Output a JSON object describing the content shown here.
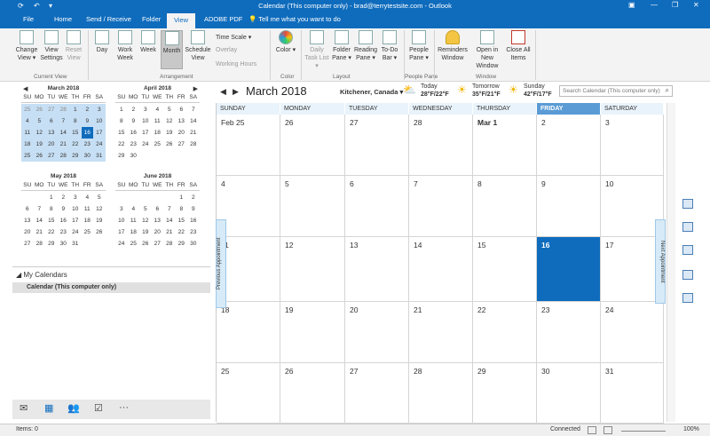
{
  "window": {
    "title": "Calendar (This computer only) - brad@terrytestsite.com - Outlook",
    "controls": [
      "▣",
      "—",
      "❐",
      "✕"
    ]
  },
  "menu": {
    "tabs": [
      "File",
      "Home",
      "Send / Receive",
      "Folder",
      "View",
      "ADOBE PDF"
    ],
    "tell_me": "Tell me what you want to do"
  },
  "ribbon": {
    "current_view": {
      "label": "Current View",
      "change_view": "Change View ▾",
      "view_settings": "View Settings",
      "reset_view": "Reset View"
    },
    "arrangement": {
      "label": "Arrangement",
      "day": "Day",
      "work_week": "Work Week",
      "week": "Week",
      "month": "Month",
      "schedule_view": "Schedule View",
      "time_scale": "Time Scale ▾",
      "overlay": "Overlay",
      "working_hours": "Working Hours"
    },
    "color": {
      "label": "Color",
      "color": "Color ▾"
    },
    "layout": {
      "label": "Layout",
      "daily_task_list": "Daily Task List ▾",
      "folder_pane": "Folder Pane ▾",
      "reading_pane": "Reading Pane ▾",
      "todo_bar": "To-Do Bar ▾"
    },
    "people_pane": {
      "label": "People Pane",
      "people_pane": "People Pane ▾"
    },
    "window": {
      "label": "Window",
      "reminders": "Reminders Window",
      "open_new": "Open in New Window",
      "close_all": "Close All Items"
    }
  },
  "mini_calendars": [
    {
      "title": "March 2018",
      "weeks": [
        [
          "25",
          "26",
          "27",
          "28",
          "1",
          "2",
          "3"
        ],
        [
          "4",
          "5",
          "6",
          "7",
          "8",
          "9",
          "10"
        ],
        [
          "11",
          "12",
          "13",
          "14",
          "15",
          "16",
          "17"
        ],
        [
          "18",
          "19",
          "20",
          "21",
          "22",
          "23",
          "24"
        ],
        [
          "25",
          "26",
          "27",
          "28",
          "29",
          "30",
          "31"
        ]
      ],
      "today": "16"
    },
    {
      "title": "April 2018",
      "weeks": [
        [
          "1",
          "2",
          "3",
          "4",
          "5",
          "6",
          "7"
        ],
        [
          "8",
          "9",
          "10",
          "11",
          "12",
          "13",
          "14"
        ],
        [
          "15",
          "16",
          "17",
          "18",
          "19",
          "20",
          "21"
        ],
        [
          "22",
          "23",
          "24",
          "25",
          "26",
          "27",
          "28"
        ],
        [
          "29",
          "30",
          "",
          "",
          "",
          "",
          ""
        ]
      ]
    },
    {
      "title": "May 2018",
      "weeks": [
        [
          "",
          "",
          "1",
          "2",
          "3",
          "4",
          "5"
        ],
        [
          "6",
          "7",
          "8",
          "9",
          "10",
          "11",
          "12"
        ],
        [
          "13",
          "14",
          "15",
          "16",
          "17",
          "18",
          "19"
        ],
        [
          "20",
          "21",
          "22",
          "23",
          "24",
          "25",
          "26"
        ],
        [
          "27",
          "28",
          "29",
          "30",
          "31",
          "",
          ""
        ]
      ]
    },
    {
      "title": "June 2018",
      "weeks": [
        [
          "",
          "",
          "",
          "",
          "",
          "1",
          "2"
        ],
        [
          "3",
          "4",
          "5",
          "6",
          "7",
          "8",
          "9"
        ],
        [
          "10",
          "11",
          "12",
          "13",
          "14",
          "15",
          "16"
        ],
        [
          "17",
          "18",
          "19",
          "20",
          "21",
          "22",
          "23"
        ],
        [
          "24",
          "25",
          "26",
          "27",
          "28",
          "29",
          "30"
        ]
      ]
    }
  ],
  "weekday_short": [
    "SU",
    "MO",
    "TU",
    "WE",
    "TH",
    "FR",
    "SA"
  ],
  "my_calendars": {
    "header": "◢ My Calendars",
    "item": "Calendar (This computer only)"
  },
  "nav": [
    "✉",
    "▦",
    "👥",
    "☑",
    "···"
  ],
  "calendar": {
    "month_title": "March 2018",
    "location": "Kitchener, Canada ▾",
    "weather": [
      {
        "label": "Today",
        "temp": "28°F/22°F"
      },
      {
        "label": "Tomorrow",
        "temp": "35°F/21°F"
      },
      {
        "label": "Sunday",
        "temp": "42°F/17°F"
      }
    ],
    "search_placeholder": "Search Calendar (This computer only)",
    "day_headers": [
      "SUNDAY",
      "MONDAY",
      "TUESDAY",
      "WEDNESDAY",
      "THURSDAY",
      "FRIDAY",
      "SATURDAY"
    ],
    "weeks": [
      [
        "Feb 25",
        "26",
        "27",
        "28",
        "Mar 1",
        "2",
        "3"
      ],
      [
        "4",
        "5",
        "6",
        "7",
        "8",
        "9",
        "10"
      ],
      [
        "11",
        "12",
        "13",
        "14",
        "15",
        "16",
        "17"
      ],
      [
        "18",
        "19",
        "20",
        "21",
        "22",
        "23",
        "24"
      ],
      [
        "25",
        "26",
        "27",
        "28",
        "29",
        "30",
        "31"
      ]
    ],
    "prev_appointment": "Previous Appointment",
    "next_appointment": "Next Appointment"
  },
  "status": {
    "items": "Items: 0",
    "connected": "Connected",
    "zoom": "100%"
  }
}
